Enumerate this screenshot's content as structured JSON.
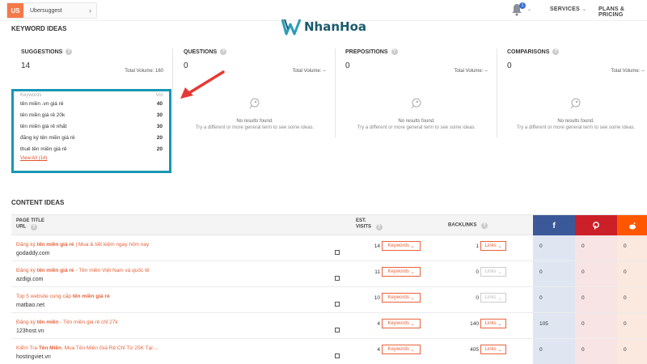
{
  "topbar": {
    "project_badge": "US",
    "project_name": "Ubersuggest",
    "notifications_count": "1",
    "nav_services": "SERVICES",
    "nav_plans": "PLANS & PRICING"
  },
  "watermark": {
    "brand": "NhanHoa"
  },
  "keyword_ideas": {
    "title": "KEYWORD IDEAS",
    "cards": [
      {
        "title": "SUGGESTIONS",
        "count": "14",
        "volume_label": "Total Volume: 160"
      },
      {
        "title": "QUESTIONS",
        "count": "0",
        "volume_label": "Total Volume: --"
      },
      {
        "title": "PREPOSITIONS",
        "count": "0",
        "volume_label": "Total Volume: --"
      },
      {
        "title": "COMPARISONS",
        "count": "0",
        "volume_label": "Total Volume: --"
      }
    ],
    "no_results": "No results found.",
    "no_results_hint": "Try a different or more general term to see some ideas.",
    "list_header_keywords": "Keywords",
    "list_header_vol": "Vol",
    "list": [
      {
        "keyword": "tên miền .vn giá rẻ",
        "vol": "40"
      },
      {
        "keyword": "tên miền giá rẻ 20k",
        "vol": "30"
      },
      {
        "keyword": "tên miền giá rẻ nhất",
        "vol": "30"
      },
      {
        "keyword": "đăng ký tên miền giá rẻ",
        "vol": "20"
      },
      {
        "keyword": "thuê tên miền giá rẻ",
        "vol": "20"
      }
    ],
    "view_all": "View All (14)"
  },
  "content_ideas": {
    "title": "CONTENT IDEAS",
    "headers": {
      "page_title": "PAGE TITLE",
      "url": "URL",
      "est": "EST.",
      "visits": "VISITS",
      "backlinks": "BACKLINKS"
    },
    "keywords_btn": "Keywords",
    "links_btn": "Links",
    "rows": [
      {
        "title_pre": "Đăng ký ",
        "title_bold": "tên miền giá rẻ",
        "title_post": " | Mua & tiết kiệm ngay hôm nay",
        "url": "godaddy.com",
        "visits": "14",
        "backlinks": "1",
        "links_disabled": false,
        "fb": "0",
        "pin": "0",
        "reddit": "0"
      },
      {
        "title_pre": "Đăng ký ",
        "title_bold": "tên miền giá rẻ",
        "title_post": " - Tên miền Việt Nam và quốc tế",
        "url": "azdigi.com",
        "visits": "11",
        "backlinks": "0",
        "links_disabled": true,
        "fb": "0",
        "pin": "0",
        "reddit": "0"
      },
      {
        "title_pre": "Top 5 website cung cấp ",
        "title_bold": "tên miền giá rẻ",
        "title_post": "",
        "url": "matbao.net",
        "visits": "10",
        "backlinks": "0",
        "links_disabled": true,
        "fb": "0",
        "pin": "0",
        "reddit": "0"
      },
      {
        "title_pre": "Đăng ký ",
        "title_bold": "tên miền",
        "title_post": " - Tên miền giá rẻ chỉ 27k",
        "url": "123host.vn",
        "visits": "4",
        "backlinks": "140",
        "links_disabled": false,
        "fb": "105",
        "pin": "0",
        "reddit": "0"
      },
      {
        "title_pre": "Kiểm Tra ",
        "title_bold": "Tên Miền",
        "title_post": ", Mua Tên Miền Giá Rẻ Chỉ Từ 25K Tại ...",
        "url": "hostingviet.vn",
        "visits": "4",
        "backlinks": "405",
        "links_disabled": false,
        "fb": "0",
        "pin": "0",
        "reddit": "0"
      }
    ]
  },
  "colors": {
    "accent": "#e8633a",
    "highlight_box": "#1a96b4",
    "facebook": "#3b5998",
    "pinterest": "#cb2027",
    "reddit": "#ff5700"
  }
}
